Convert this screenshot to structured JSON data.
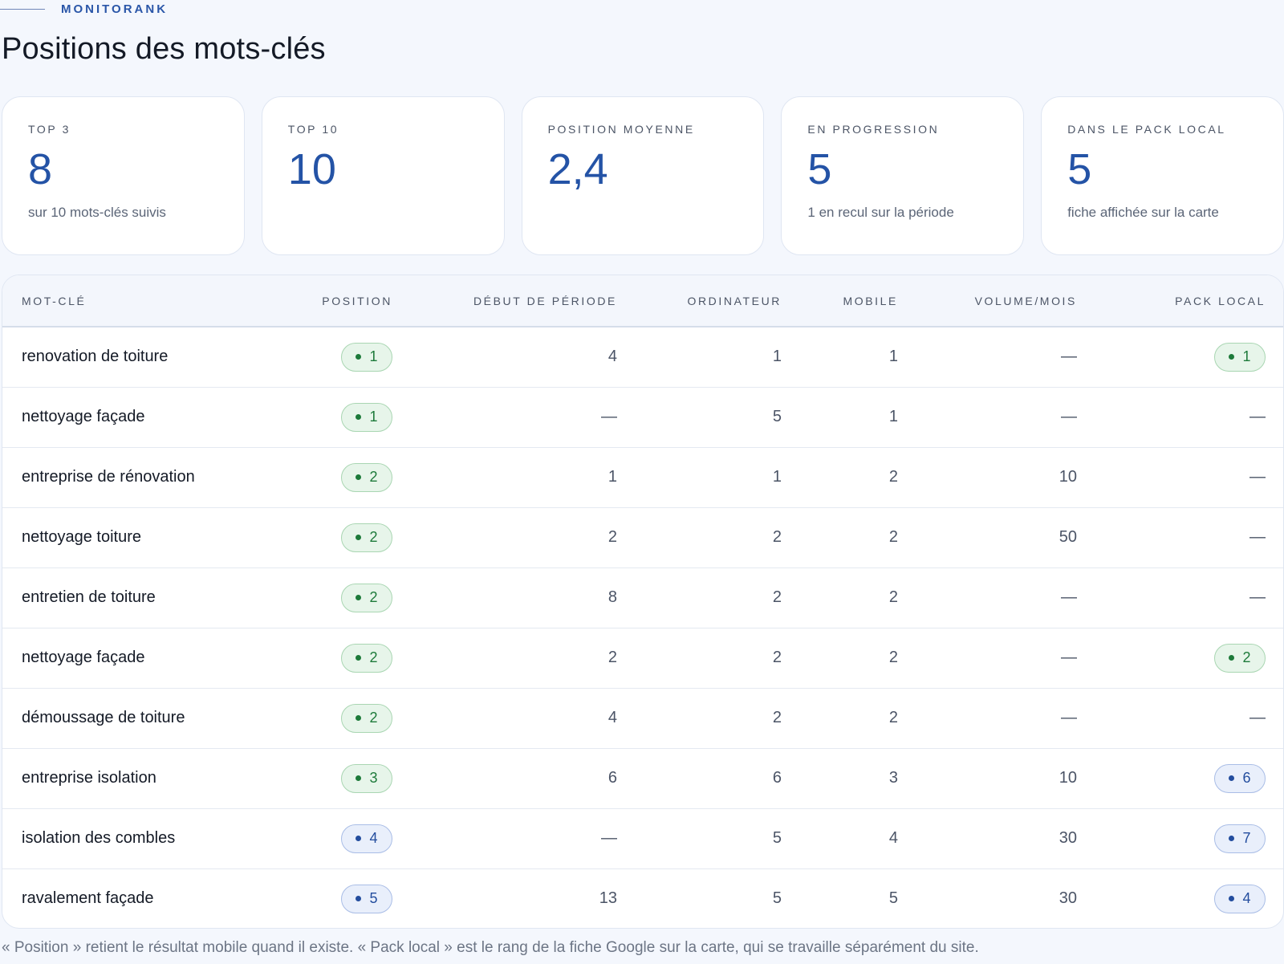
{
  "brand": "MONITORANK",
  "title": "Positions des mots-clés",
  "stats": [
    {
      "label": "TOP 3",
      "value": "8",
      "sub": "sur 10 mots-clés suivis"
    },
    {
      "label": "TOP 10",
      "value": "10",
      "sub": ""
    },
    {
      "label": "POSITION MOYENNE",
      "value": "2,4",
      "sub": ""
    },
    {
      "label": "EN PROGRESSION",
      "value": "5",
      "sub": "1 en recul sur la période"
    },
    {
      "label": "DANS LE PACK LOCAL",
      "value": "5",
      "sub": "fiche affichée sur la carte"
    }
  ],
  "table": {
    "headers": [
      "MOT-CLÉ",
      "POSITION",
      "DÉBUT DE PÉRIODE",
      "ORDINATEUR",
      "MOBILE",
      "VOLUME/MOIS",
      "PACK LOCAL"
    ],
    "rows": [
      {
        "keyword": "renovation de toiture",
        "position": "1",
        "position_color": "green",
        "start": "4",
        "desktop": "1",
        "mobile": "1",
        "volume": "—",
        "pack": "1",
        "pack_color": "green"
      },
      {
        "keyword": "nettoyage façade",
        "position": "1",
        "position_color": "green",
        "start": "—",
        "desktop": "5",
        "mobile": "1",
        "volume": "—",
        "pack": "—",
        "pack_color": ""
      },
      {
        "keyword": "entreprise de rénovation",
        "position": "2",
        "position_color": "green",
        "start": "1",
        "desktop": "1",
        "mobile": "2",
        "volume": "10",
        "pack": "—",
        "pack_color": ""
      },
      {
        "keyword": "nettoyage toiture",
        "position": "2",
        "position_color": "green",
        "start": "2",
        "desktop": "2",
        "mobile": "2",
        "volume": "50",
        "pack": "—",
        "pack_color": ""
      },
      {
        "keyword": "entretien de toiture",
        "position": "2",
        "position_color": "green",
        "start": "8",
        "desktop": "2",
        "mobile": "2",
        "volume": "—",
        "pack": "—",
        "pack_color": ""
      },
      {
        "keyword": "nettoyage façade",
        "position": "2",
        "position_color": "green",
        "start": "2",
        "desktop": "2",
        "mobile": "2",
        "volume": "—",
        "pack": "2",
        "pack_color": "green"
      },
      {
        "keyword": "démoussage de toiture",
        "position": "2",
        "position_color": "green",
        "start": "4",
        "desktop": "2",
        "mobile": "2",
        "volume": "—",
        "pack": "—",
        "pack_color": ""
      },
      {
        "keyword": "entreprise isolation",
        "position": "3",
        "position_color": "green",
        "start": "6",
        "desktop": "6",
        "mobile": "3",
        "volume": "10",
        "pack": "6",
        "pack_color": "blue"
      },
      {
        "keyword": "isolation des combles",
        "position": "4",
        "position_color": "blue",
        "start": "—",
        "desktop": "5",
        "mobile": "4",
        "volume": "30",
        "pack": "7",
        "pack_color": "blue"
      },
      {
        "keyword": "ravalement façade",
        "position": "5",
        "position_color": "blue",
        "start": "13",
        "desktop": "5",
        "mobile": "5",
        "volume": "30",
        "pack": "4",
        "pack_color": "blue"
      }
    ]
  },
  "colors": {
    "accent": "#2453a6",
    "good_badge": "#1d7a3a",
    "neutral_badge": "#234d9e",
    "background": "#f4f7fd"
  },
  "footnote": "« Position » retient le résultat mobile quand il existe. « Pack local » est le rang de la fiche Google sur la carte, qui se travaille séparément du site."
}
